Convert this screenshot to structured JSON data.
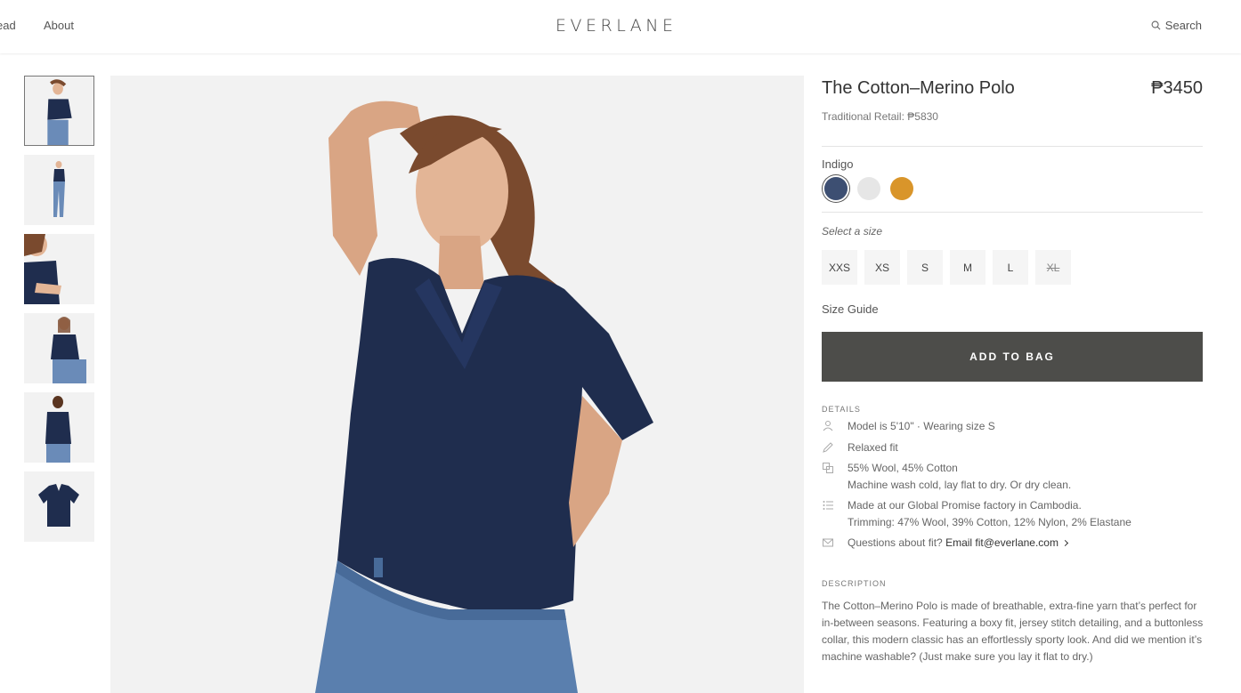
{
  "header": {
    "nav_read": "ead",
    "nav_about": "About",
    "logo": "EVERLANE",
    "search_label": "Search"
  },
  "product": {
    "title": "The Cotton–Merino Polo",
    "price": "₱3450",
    "retail": "Traditional Retail: ₱5830",
    "color_name": "Indigo",
    "swatches": [
      {
        "name": "indigo",
        "color": "#3d4f72"
      },
      {
        "name": "white",
        "color": "#e6e6e6"
      },
      {
        "name": "mustard",
        "color": "#d9952a"
      }
    ],
    "size_label": "Select a size",
    "sizes": [
      "XXS",
      "XS",
      "S",
      "M",
      "L",
      "XL"
    ],
    "size_guide": "Size Guide",
    "add_to_bag": "ADD TO BAG"
  },
  "details": {
    "heading": "DETAILS",
    "model": "Model is 5'10\"  ·  Wearing size S",
    "fit": "Relaxed fit",
    "fabric_1": "55% Wool, 45% Cotton",
    "fabric_2": "Machine wash cold, lay flat to dry. Or dry clean.",
    "factory_1": "Made at our Global Promise factory in Cambodia.",
    "factory_2": "Trimming: 47% Wool, 39% Cotton, 12% Nylon, 2% Elastane",
    "questions": "Questions about fit?",
    "email": "Email fit@everlane.com"
  },
  "description": {
    "heading": "DESCRIPTION",
    "text": "The Cotton–Merino Polo is made of breathable, extra-fine yarn that’s perfect for in-between seasons. Featuring a boxy fit, jersey stitch detailing, and a buttonless collar, this modern classic has an effortlessly sporty look. And did we mention it’s machine washable? (Just make sure you lay it flat to dry.)"
  },
  "colors": {
    "button_bg": "#4d4d4a",
    "shirt": "#1f2d4e",
    "jeans": "#5a7fae"
  }
}
